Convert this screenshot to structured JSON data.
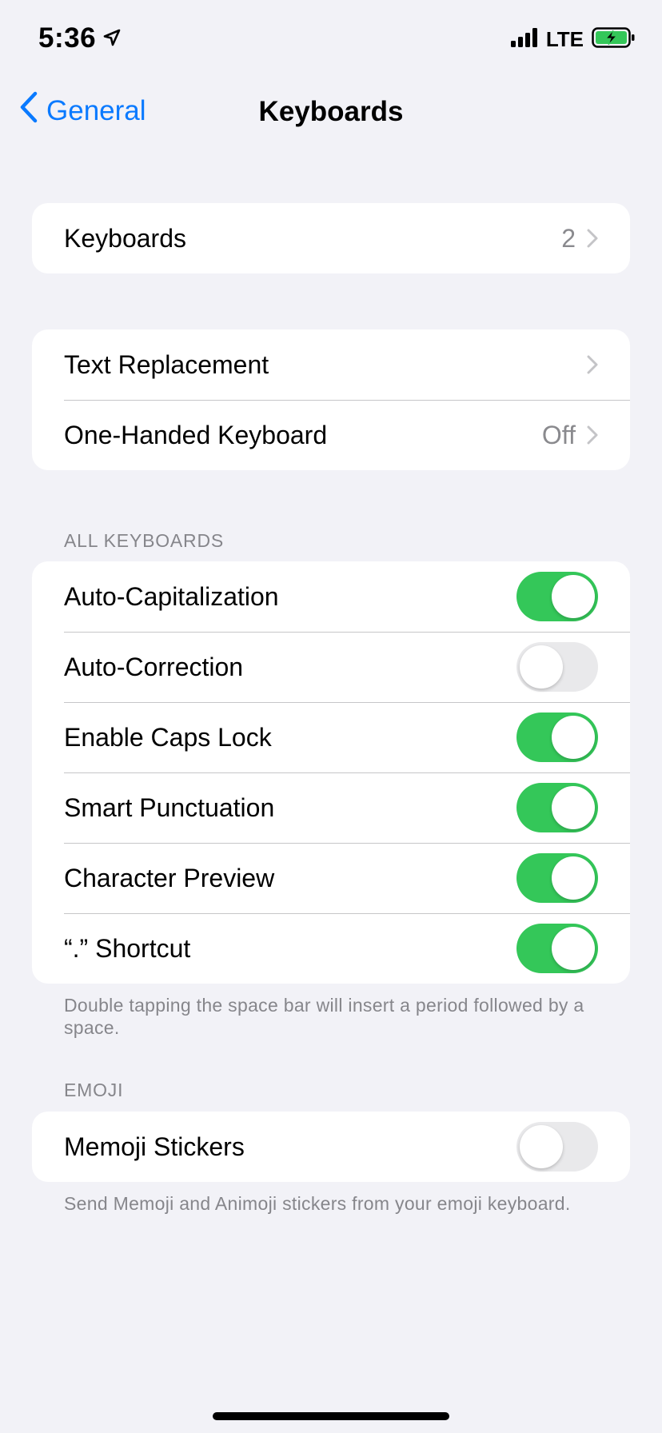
{
  "status_bar": {
    "time": "5:36",
    "network": "LTE"
  },
  "nav": {
    "back_label": "General",
    "title": "Keyboards"
  },
  "group1": {
    "keyboards": {
      "label": "Keyboards",
      "value": "2"
    }
  },
  "group2": {
    "text_replacement": {
      "label": "Text Replacement"
    },
    "one_handed": {
      "label": "One-Handed Keyboard",
      "value": "Off"
    }
  },
  "all_keyboards": {
    "header": "ALL KEYBOARDS",
    "items": [
      {
        "label": "Auto-Capitalization",
        "on": true
      },
      {
        "label": "Auto-Correction",
        "on": false
      },
      {
        "label": "Enable Caps Lock",
        "on": true
      },
      {
        "label": "Smart Punctuation",
        "on": true
      },
      {
        "label": "Character Preview",
        "on": true
      },
      {
        "label": "“.” Shortcut",
        "on": true
      }
    ],
    "footer": "Double tapping the space bar will insert a period followed by a space."
  },
  "emoji": {
    "header": "EMOJI",
    "memoji": {
      "label": "Memoji Stickers",
      "on": false
    },
    "footer": "Send Memoji and Animoji stickers from your emoji keyboard."
  },
  "colors": {
    "accent": "#0a7aff",
    "toggle_on": "#34c759",
    "toggle_off": "#e9e9eb",
    "background": "#f2f2f7"
  }
}
